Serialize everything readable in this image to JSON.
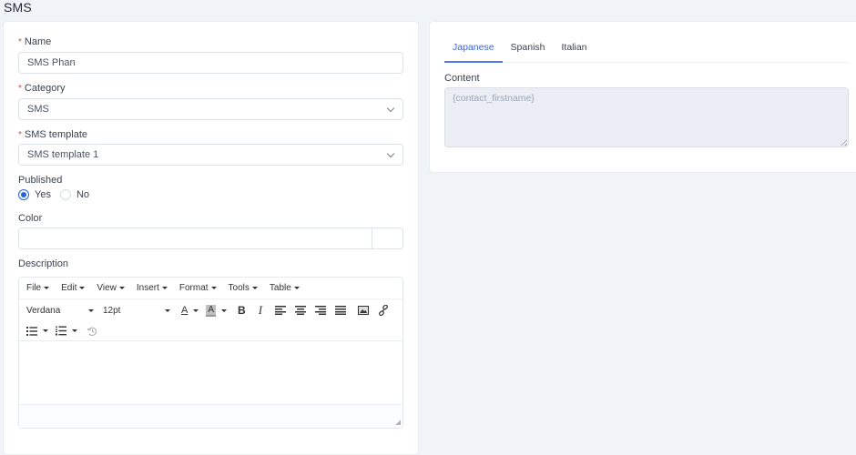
{
  "page": {
    "title": "SMS"
  },
  "form": {
    "name": {
      "label": "Name",
      "required": true,
      "value": "SMS Phan"
    },
    "category": {
      "label": "Category",
      "required": true,
      "selected": "SMS"
    },
    "sms_template": {
      "label": "SMS template",
      "required": true,
      "selected": "SMS template 1"
    },
    "published": {
      "label": "Published",
      "options": [
        "Yes",
        "No"
      ],
      "selected": "Yes"
    },
    "color": {
      "label": "Color",
      "value": ""
    },
    "description": {
      "label": "Description",
      "menubar": [
        "File",
        "Edit",
        "View",
        "Insert",
        "Format",
        "Tools",
        "Table"
      ],
      "font_family": "Verdana",
      "font_size": "12pt",
      "toolbar_icons": [
        "text-color-icon",
        "background-color-icon",
        "bold-icon",
        "italic-icon",
        "align-left-icon",
        "align-center-icon",
        "align-right-icon",
        "align-justify-icon",
        "image-icon",
        "link-icon",
        "bullet-list-icon",
        "numbered-list-icon",
        "history-icon"
      ],
      "text_color_glyph": "A",
      "bg_color_glyph": "A",
      "bold_glyph": "B",
      "italic_glyph": "I"
    }
  },
  "translations": {
    "tabs": [
      {
        "label": "Japanese",
        "active": true
      },
      {
        "label": "Spanish",
        "active": false
      },
      {
        "label": "Italian",
        "active": false
      }
    ],
    "content_label": "Content",
    "content_value": "{contact_firstname}"
  },
  "colors": {
    "accent": "#2563eb",
    "tab_active": "#3b63d9",
    "required": "#e5484d",
    "background": "#f0f3f8"
  }
}
